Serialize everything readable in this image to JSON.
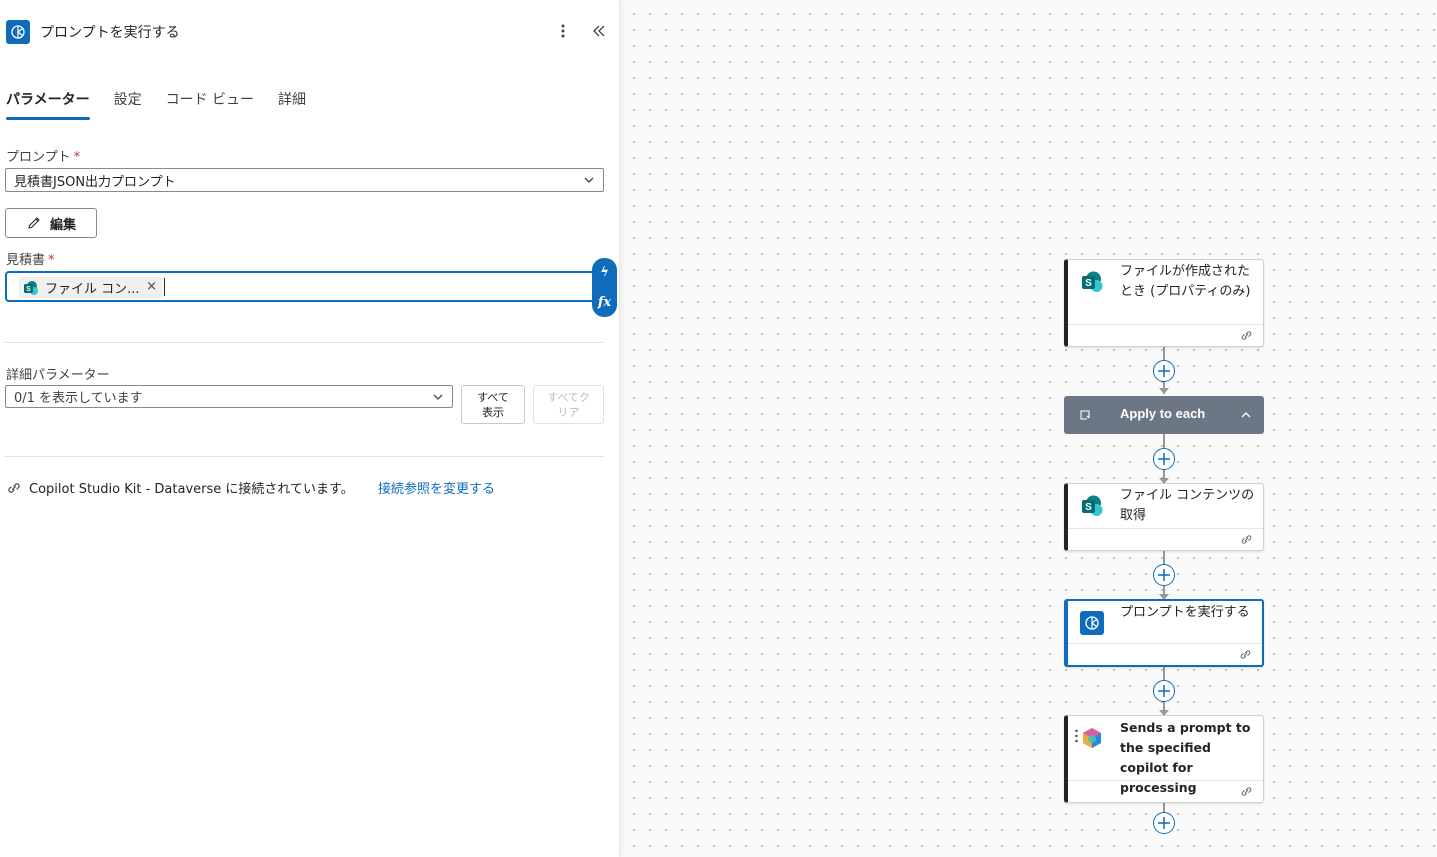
{
  "panel": {
    "title": "プロンプトを実行する",
    "tabs": [
      {
        "label": "パラメーター",
        "active": true
      },
      {
        "label": "設定",
        "active": false
      },
      {
        "label": "コード ビュー",
        "active": false
      },
      {
        "label": "詳細",
        "active": false
      }
    ],
    "prompt_label": "プロンプト",
    "prompt_value": "見積書JSON出力プロンプト",
    "edit_label": "編集",
    "quote_label": "見積書",
    "required_mark": "*",
    "token_label": "ファイル コン...",
    "token_remove": "×",
    "side_lightning": "ϟ",
    "side_fx": "fx",
    "advanced_label": "詳細パラメーター",
    "advanced_value": "0/1 を表示しています",
    "show_all_label": "すべて\n表示",
    "clear_all_label": "すべてク\nリア",
    "connection_text": "Copilot Studio Kit - Dataverse に接続されています。",
    "change_connection_label": "接続参照を変更する"
  },
  "flow": {
    "trigger_title": "ファイルが作成されたとき (プロパティのみ)",
    "loop_title": "Apply to each",
    "get_content_title": "ファイル コンテンツの取得",
    "run_prompt_title": "プロンプトを実行する",
    "copilot_title": "Sends a prompt to the specified copilot for processing"
  },
  "colors": {
    "accent": "#0f6cbd",
    "loop_header": "#6b7785",
    "sharepoint_teal": "#038387",
    "required": "#c4314b"
  },
  "icons": {
    "app": "ai-builder-icon",
    "more": "more-vertical-icon",
    "collapse": "double-chevron-left-icon",
    "edit": "pencil-icon",
    "connection": "link-icon",
    "sharepoint": "sharepoint-icon",
    "copilot": "copilot-studio-icon",
    "loop": "loop-icon",
    "add": "plus-circle-icon"
  }
}
